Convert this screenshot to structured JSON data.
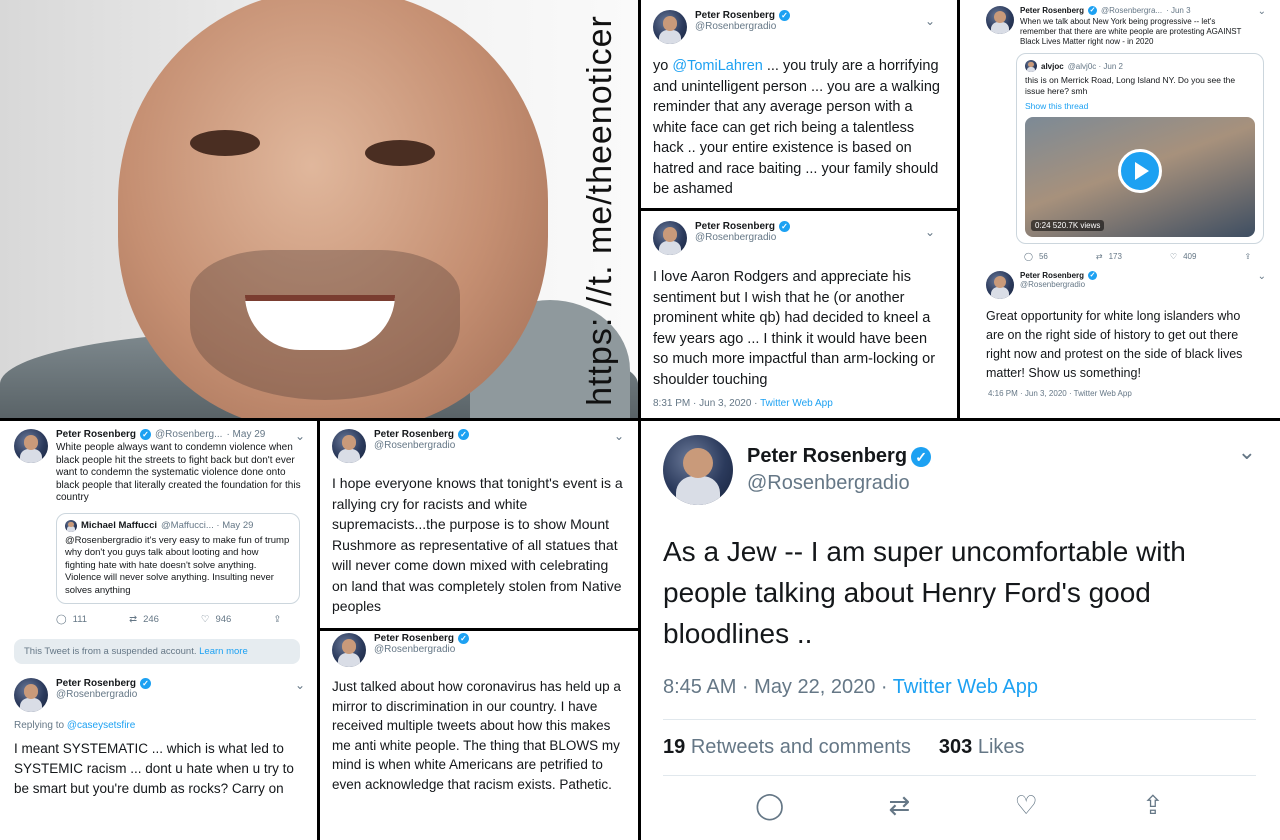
{
  "watermark": "https: //t. me/theenoticer",
  "profile": {
    "name": "Peter Rosenberg",
    "handle": "@Rosenbergradio",
    "handle_short": "@Rosenbergra...",
    "verified_mark": "✓"
  },
  "chevron": "⌄",
  "tweet_tomi": {
    "mention": "@TomiLahren",
    "prefix": "yo",
    "text": " ... you truly are a horrifying and unintelligent person ... you are a walking reminder that any average person with a white face can get rich being a talentless hack .. your entire existence is based on hatred and race baiting ... your family should be ashamed"
  },
  "tweet_rodgers": {
    "text": "I love Aaron Rodgers and appreciate his sentiment but I wish that he (or another prominent white qb) had decided to kneel a few years ago ... I think it would have been so much more impactful than arm-locking or shoulder touching",
    "time": "8:31 PM · Jun 3, 2020 ·",
    "source": "Twitter Web App"
  },
  "tweet_longisland": {
    "date": "· Jun 3",
    "text": "When we talk about New York being progressive -- let's remember that there are white people are protesting AGAINST Black Lives Matter right now - in 2020",
    "quote": {
      "name": "alvjoc",
      "handle": "@alvj0c · Jun 2",
      "text": "this is on Merrick Road, Long Island NY. Do you see the issue here? smh",
      "show_thread": "Show this thread",
      "video_stat": "0:24  520.7K views"
    },
    "actions": {
      "reply": "56",
      "retweet": "173",
      "like": "409"
    }
  },
  "tweet_opportunity": {
    "text": "Great opportunity for white long islanders who are on the right side of history to get out there right now and protest on the side of black lives matter! Show us something!",
    "footer": "4:16 PM · Jun 3, 2020 · Twitter Web App"
  },
  "tweet_condemn": {
    "handle": "@Rosenberg...",
    "date": "· May 29",
    "text": "White people always want to condemn violence when black people hit the streets to fight back but don't ever want to condemn the systematic violence done onto black people that literally created the foundation for this country",
    "quote": {
      "name": "Michael Maffucci",
      "handle": "@Maffucci... · May 29",
      "text": "@Rosenbergradio it's very easy to make fun of trump why don't you guys talk about looting and how fighting hate with hate doesn't solve anything. Violence will never solve anything. Insulting never solves anything"
    },
    "actions": {
      "reply": "111",
      "retweet": "246",
      "like": "946"
    },
    "suspended": "This Tweet is from a suspended account.",
    "learn_more": "Learn more"
  },
  "tweet_systematic": {
    "replying_to": "Replying to",
    "reply_handle": "@caseysetsfire",
    "text": "I meant SYSTEMATIC ... which is what led to SYSTEMIC racism ... dont u hate when u try to be smart but you're dumb as rocks? Carry on"
  },
  "tweet_rushmore": {
    "text": "I hope everyone knows that tonight's event is a rallying cry for racists and white supremacists...the purpose is to show Mount Rushmore as representative of all statues that will never come down mixed with celebrating on land that was completely stolen from Native peoples"
  },
  "tweet_coronavirus": {
    "text": "Just talked about how coronavirus has held up a mirror to discrimination in our country. I have received multiple tweets about how this makes me anti white people. The thing that BLOWS my mind is when white Americans are petrified to even acknowledge that racism exists. Pathetic."
  },
  "tweet_ford": {
    "text": "As a Jew -- I am super uncomfortable with people talking about Henry Ford's good bloodlines ..",
    "time": "8:45 AM · May 22, 2020 ·",
    "source": "Twitter Web App",
    "retweets_count": "19",
    "retweets_label": "Retweets and comments",
    "likes_count": "303",
    "likes_label": "Likes"
  },
  "icons": {
    "reply": "◯",
    "retweet": "⇄",
    "like": "♡",
    "share": "⇪"
  },
  "colors": {
    "link": "#1da1f2",
    "meta": "#657786",
    "text": "#14171a",
    "border": "#000000"
  }
}
